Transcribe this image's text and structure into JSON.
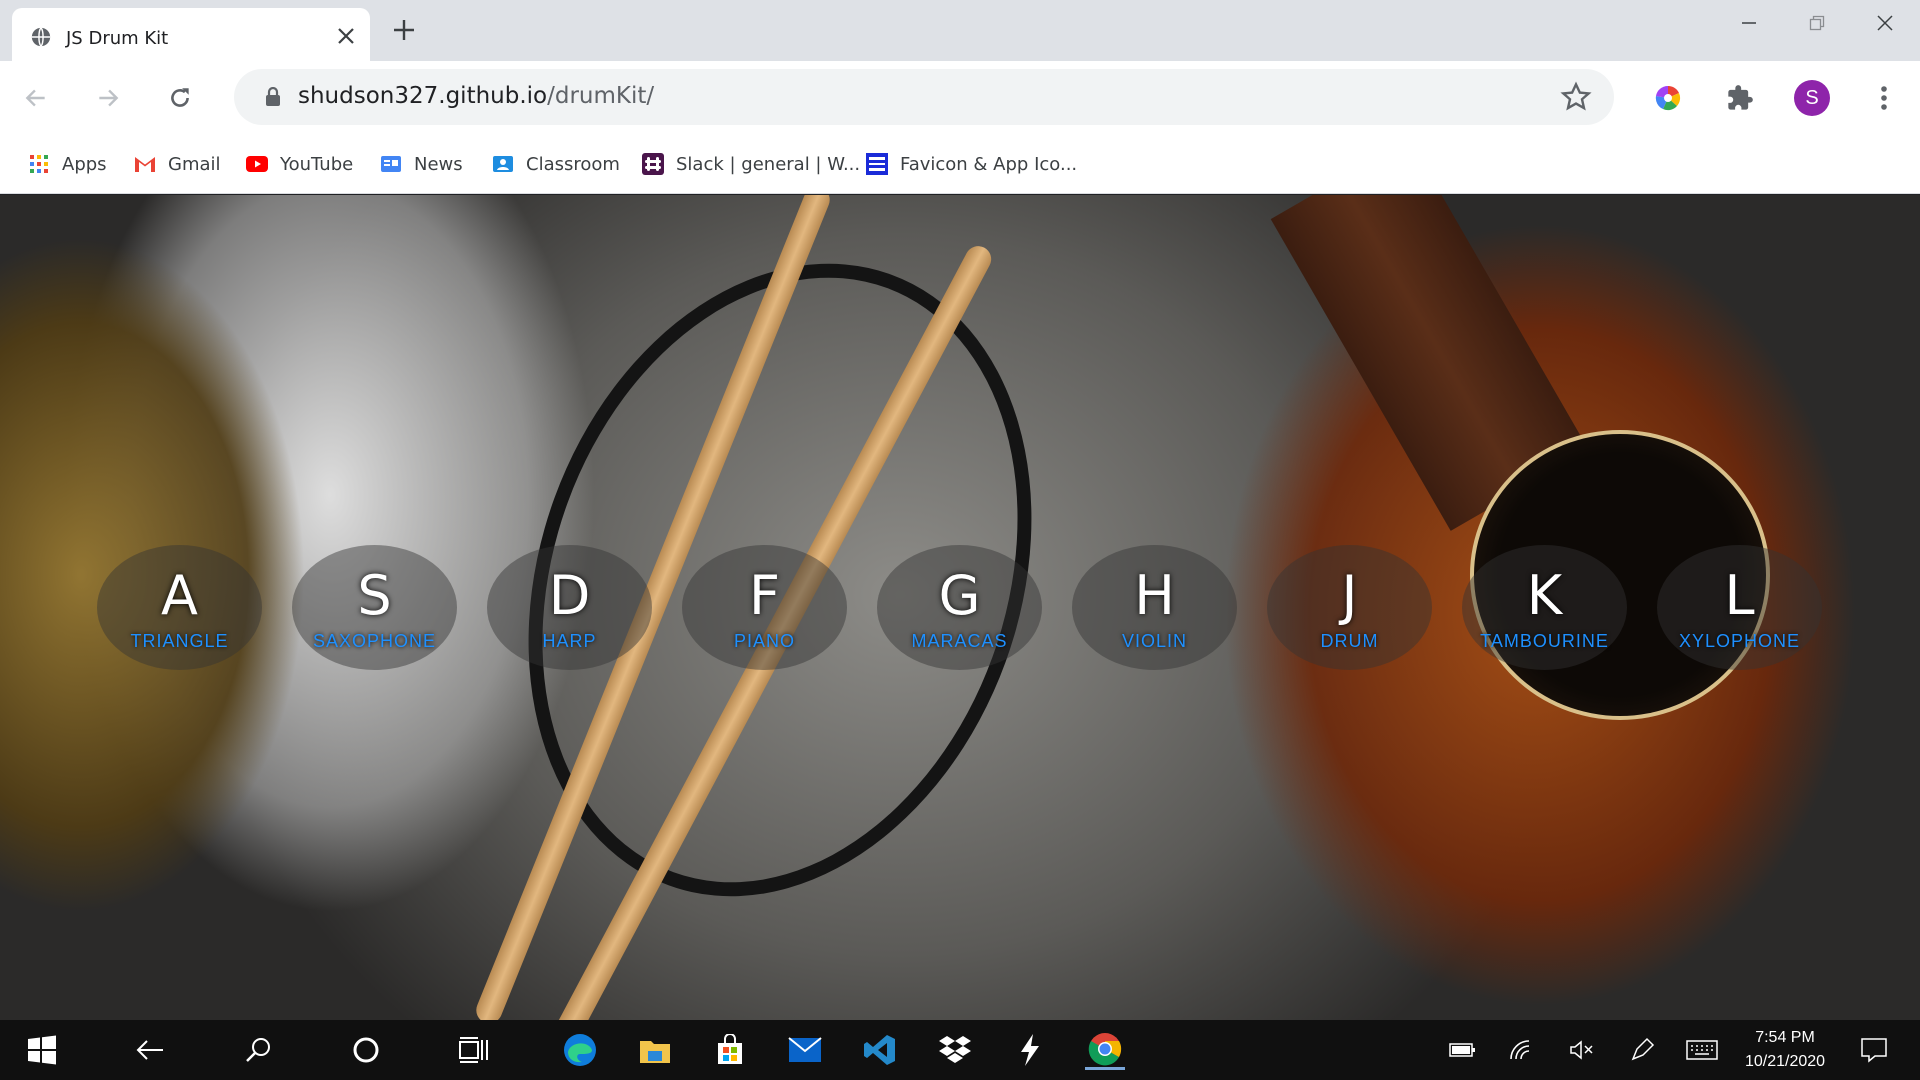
{
  "browser": {
    "tab_title": "JS Drum Kit",
    "url_host": "shudson327.github.io",
    "url_path": "/drumKit/",
    "profile_initial": "S"
  },
  "bookmarks": [
    {
      "label": "Apps",
      "icon": "apps-grid-icon"
    },
    {
      "label": "Gmail",
      "icon": "gmail-icon"
    },
    {
      "label": "YouTube",
      "icon": "youtube-icon"
    },
    {
      "label": "News",
      "icon": "google-news-icon"
    },
    {
      "label": "Classroom",
      "icon": "classroom-icon"
    },
    {
      "label": "Slack | general | W...",
      "icon": "slack-icon"
    },
    {
      "label": "Favicon & App Ico...",
      "icon": "favicon-generator-icon"
    }
  ],
  "drumkit": {
    "keys": [
      {
        "key": "A",
        "sound": "TRIANGLE"
      },
      {
        "key": "S",
        "sound": "SAXOPHONE"
      },
      {
        "key": "D",
        "sound": "HARP"
      },
      {
        "key": "F",
        "sound": "PIANO"
      },
      {
        "key": "G",
        "sound": "MARACAS"
      },
      {
        "key": "H",
        "sound": "VIOLIN"
      },
      {
        "key": "J",
        "sound": "DRUM"
      },
      {
        "key": "K",
        "sound": "TAMBOURINE"
      },
      {
        "key": "L",
        "sound": "XYLOPHONE"
      }
    ]
  },
  "taskbar": {
    "time": "7:54 PM",
    "date": "10/21/2020"
  },
  "colors": {
    "sound_label": "#1e90ff",
    "profile_avatar": "#8e24aa"
  }
}
